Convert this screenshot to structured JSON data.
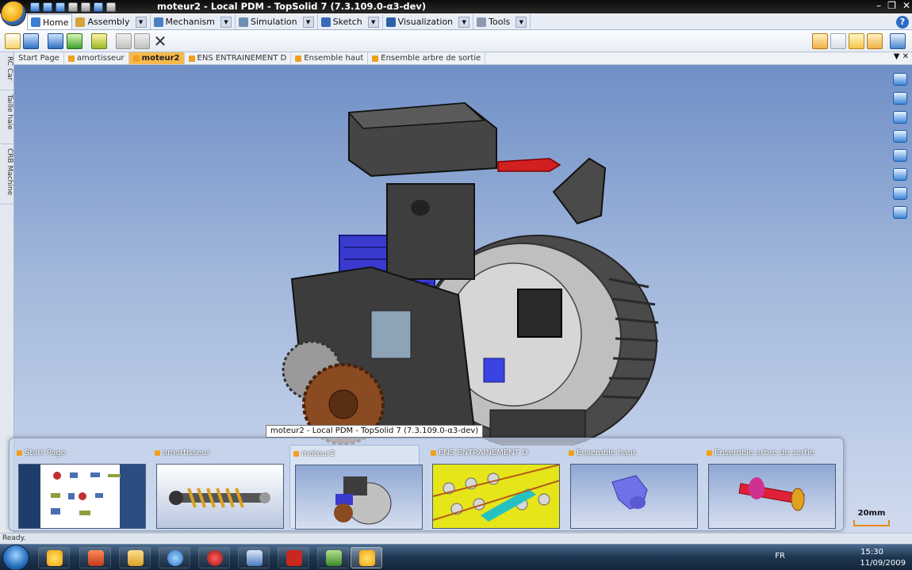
{
  "window": {
    "title": "moteur2 - Local PDM - TopSolid 7 (7.3.109.0-α3-dev)",
    "controls": [
      "minimize-icon",
      "restore-icon",
      "close-icon"
    ]
  },
  "ribbon_tabs": [
    {
      "label": "Home",
      "icon": "home-icon",
      "active": true
    },
    {
      "label": "Assembly",
      "icon": "assembly-icon"
    },
    {
      "label": "Mechanism",
      "icon": "mechanism-icon"
    },
    {
      "label": "Simulation",
      "icon": "simulation-icon"
    },
    {
      "label": "Sketch",
      "icon": "sketch-icon"
    },
    {
      "label": "Visualization",
      "icon": "visualization-icon"
    },
    {
      "label": "Tools",
      "icon": "tools-icon"
    }
  ],
  "doc_tabs": [
    {
      "label": "Start Page"
    },
    {
      "label": "amortisseur"
    },
    {
      "label": "moteur2",
      "active": true
    },
    {
      "label": "ENS ENTRAINEMENT D"
    },
    {
      "label": "Ensemble haut"
    },
    {
      "label": "Ensemble arbre de sortie"
    }
  ],
  "left_dock": [
    "RC Car",
    "Taille haie",
    "CRB Machine"
  ],
  "tooltip": "moteur2 - Local PDM - TopSolid 7 (7.3.109.0-α3-dev)",
  "switcher": [
    {
      "label": "Start Page"
    },
    {
      "label": "amortisseur"
    },
    {
      "label": "moteur2",
      "active": true
    },
    {
      "label": "ENS ENTRAINEMENT D"
    },
    {
      "label": "Ensemble haut"
    },
    {
      "label": "Ensemble arbre de sortie"
    }
  ],
  "scale": "20mm",
  "status": "Ready.",
  "taskbar": {
    "language": "FR",
    "time": "15:30",
    "date": "11/09/2009"
  },
  "colors": {
    "viewport_top": "#6f8fc6",
    "viewport_bottom": "#d2dcef",
    "active_tab": "#f7b94c",
    "engine_dark": "#3a3a3a",
    "gear_bronze": "#8a4a22"
  }
}
